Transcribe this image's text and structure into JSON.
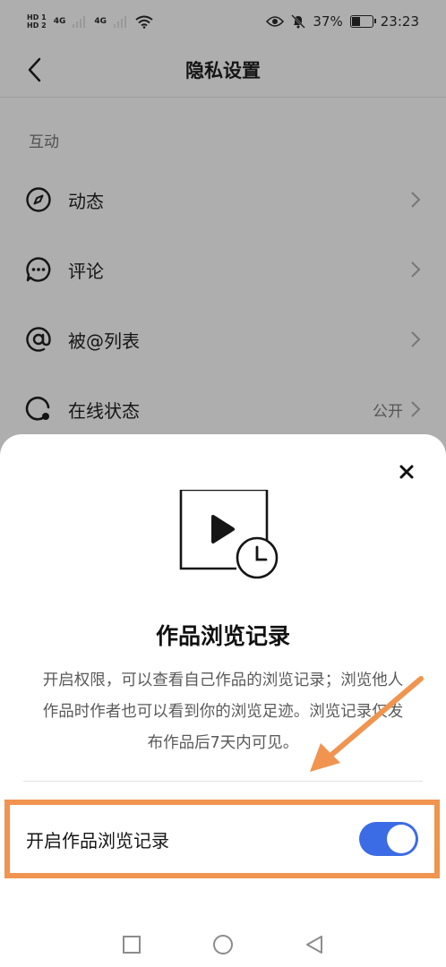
{
  "status_bar": {
    "sim1": "HD 1",
    "sim2": "HD 2",
    "network1": "4G",
    "network2": "4G",
    "battery_percent": "37%",
    "time": "23:23"
  },
  "header": {
    "title": "隐私设置"
  },
  "section": {
    "label": "互动"
  },
  "settings_items": [
    {
      "label": "动态",
      "value": ""
    },
    {
      "label": "评论",
      "value": ""
    },
    {
      "label": "被@列表",
      "value": ""
    },
    {
      "label": "在线状态",
      "value": "公开"
    }
  ],
  "sheet": {
    "title": "作品浏览记录",
    "description": "开启权限，可以查看自己作品的浏览记录；浏览他人作品时作者也可以看到你的浏览足迹。浏览记录仅发布作品后7天内可见。",
    "toggle_label": "开启作品浏览记录",
    "toggle_on": true
  },
  "colors": {
    "toggle_accent": "#3b6ce5",
    "highlight_annotation": "#f0944f",
    "overlay": "#aeaeae"
  },
  "icons": [
    "back-arrow-icon",
    "compass-icon",
    "chat-bubble-icon",
    "at-sign-icon",
    "online-status-icon",
    "chevron-right-icon",
    "close-icon",
    "video-history-icon",
    "square-icon",
    "circle-icon",
    "triangle-back-icon"
  ]
}
